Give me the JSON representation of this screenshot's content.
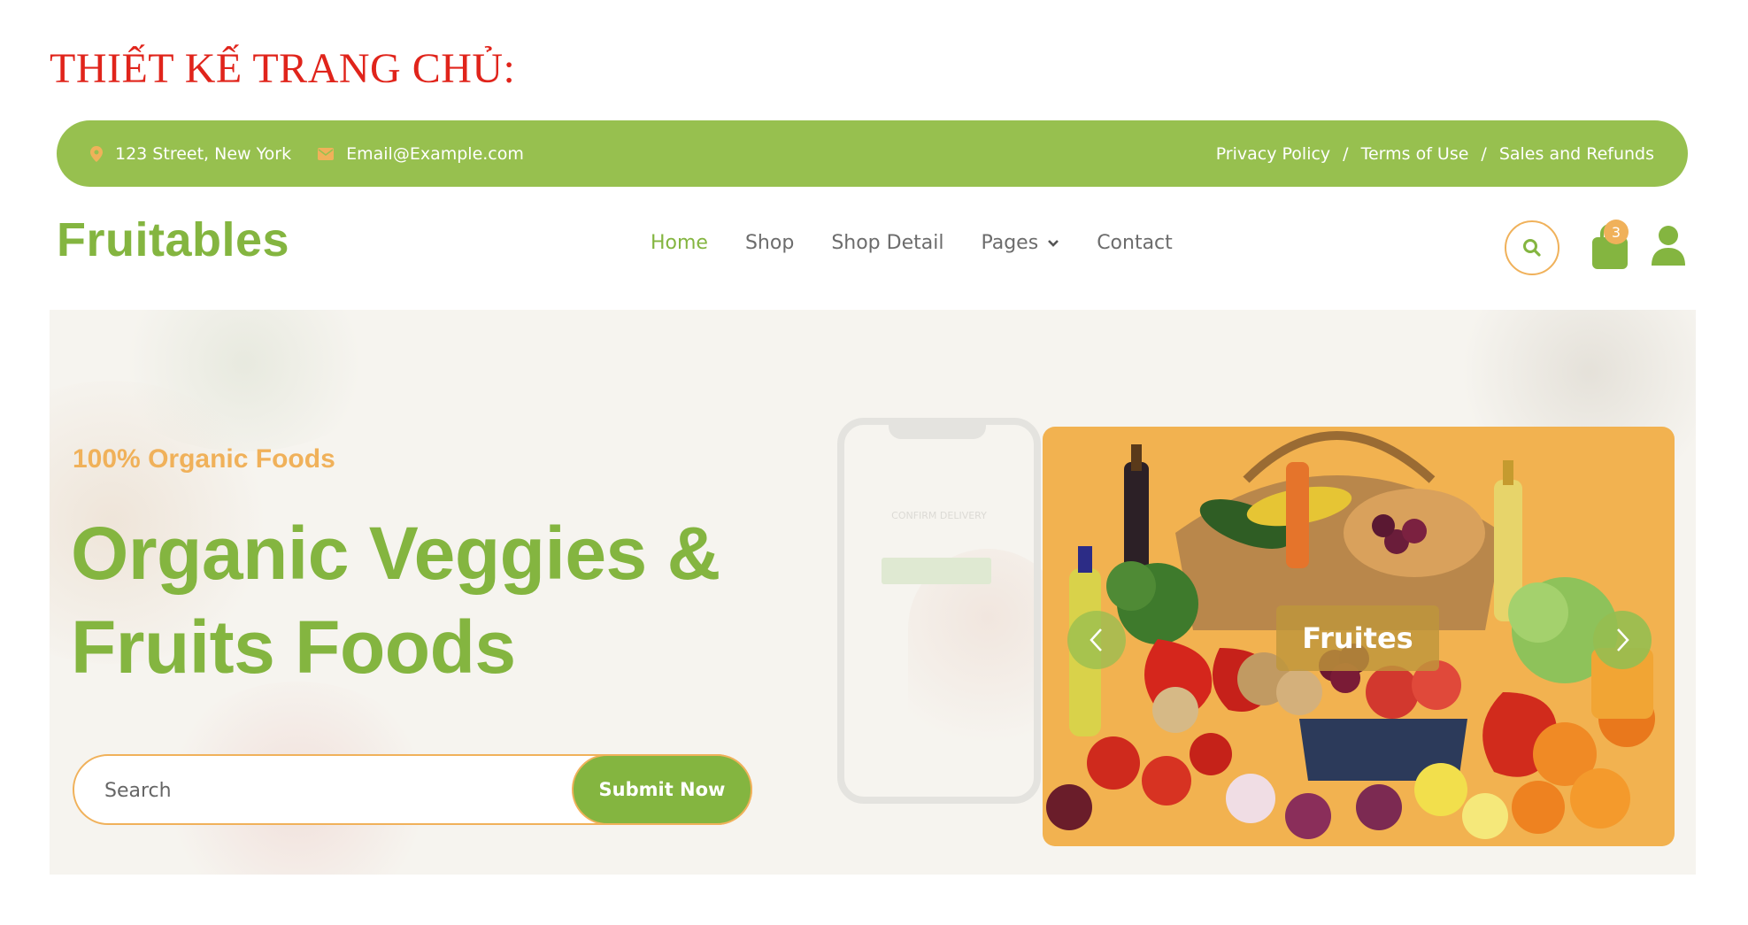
{
  "heading": "THIẾT KẾ TRANG CHỦ:",
  "topbar": {
    "address": "123 Street, New York",
    "email": "Email@Example.com",
    "links": [
      "Privacy Policy",
      "Terms of Use",
      "Sales and Refunds"
    ],
    "separator": "/"
  },
  "brand": "Fruitables",
  "nav": {
    "items": [
      "Home",
      "Shop",
      "Shop Detail",
      "Pages",
      "Contact"
    ],
    "active": "Home"
  },
  "cart": {
    "count": "3"
  },
  "hero": {
    "tagline": "100% Organic Foods",
    "title_line1": "Organic Veggies &",
    "title_line2": "Fruits Foods",
    "search_placeholder": "Search",
    "submit_label": "Submit Now",
    "phone_text": "CONFIRM DELIVERY",
    "slide_label": "Fruites"
  },
  "colors": {
    "green": "#84b540",
    "bar_green": "#97c04f",
    "orange": "#f0b15a",
    "heading_red": "#e0241b"
  }
}
